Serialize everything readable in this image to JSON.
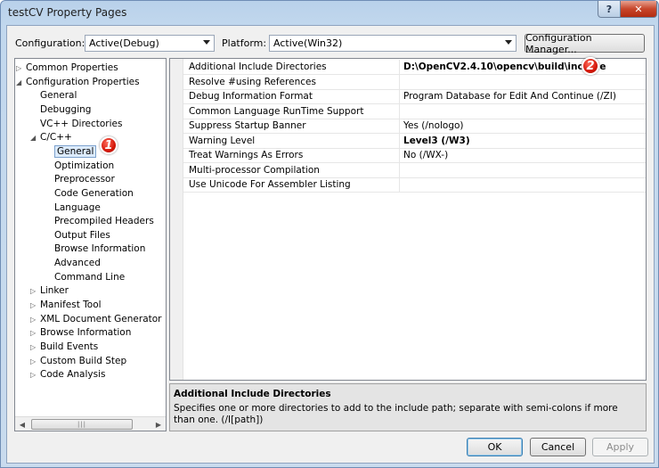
{
  "window": {
    "title": "testCV Property Pages",
    "help_label": "?",
    "close_label": "✕"
  },
  "toolbar": {
    "configuration_label": "Configuration:",
    "configuration_value": "Active(Debug)",
    "platform_label": "Platform:",
    "platform_value": "Active(Win32)",
    "config_manager_label": "Configuration Manager..."
  },
  "tree": {
    "items": [
      {
        "label": "Common Properties",
        "arrow": "▷"
      },
      {
        "label": "Configuration Properties",
        "arrow": "◢"
      },
      {
        "label": "General"
      },
      {
        "label": "Debugging"
      },
      {
        "label": "VC++ Directories"
      },
      {
        "label": "C/C++",
        "arrow": "◢"
      },
      {
        "label": "General",
        "selected": true
      },
      {
        "label": "Optimization"
      },
      {
        "label": "Preprocessor"
      },
      {
        "label": "Code Generation"
      },
      {
        "label": "Language"
      },
      {
        "label": "Precompiled Headers"
      },
      {
        "label": "Output Files"
      },
      {
        "label": "Browse Information"
      },
      {
        "label": "Advanced"
      },
      {
        "label": "Command Line"
      },
      {
        "label": "Linker",
        "arrow": "▷"
      },
      {
        "label": "Manifest Tool",
        "arrow": "▷"
      },
      {
        "label": "XML Document Generator",
        "arrow": "▷"
      },
      {
        "label": "Browse Information",
        "arrow": "▷"
      },
      {
        "label": "Build Events",
        "arrow": "▷"
      },
      {
        "label": "Custom Build Step",
        "arrow": "▷"
      },
      {
        "label": "Code Analysis",
        "arrow": "▷"
      }
    ],
    "scroll_left": "◀",
    "scroll_right": "▶",
    "scroll_grip": "|||"
  },
  "grid": {
    "rows": [
      {
        "name": "Additional Include Directories",
        "value": "D:\\OpenCV2.4.10\\opencv\\build\\include",
        "bold": true
      },
      {
        "name": "Resolve #using References",
        "value": ""
      },
      {
        "name": "Debug Information Format",
        "value": "Program Database for Edit And Continue (/ZI)"
      },
      {
        "name": "Common Language RunTime Support",
        "value": ""
      },
      {
        "name": "Suppress Startup Banner",
        "value": "Yes (/nologo)"
      },
      {
        "name": "Warning Level",
        "value": "Level3 (/W3)",
        "bold": true
      },
      {
        "name": "Treat Warnings As Errors",
        "value": "No (/WX-)"
      },
      {
        "name": "Multi-processor Compilation",
        "value": ""
      },
      {
        "name": "Use Unicode For Assembler Listing",
        "value": ""
      }
    ]
  },
  "badges": {
    "one": "1",
    "two": "2"
  },
  "description": {
    "title": "Additional Include Directories",
    "text": "Specifies one or more directories to add to the include path; separate with semi-colons if more than one. (/I[path])"
  },
  "buttons": {
    "ok": "OK",
    "cancel": "Cancel",
    "apply": "Apply"
  }
}
